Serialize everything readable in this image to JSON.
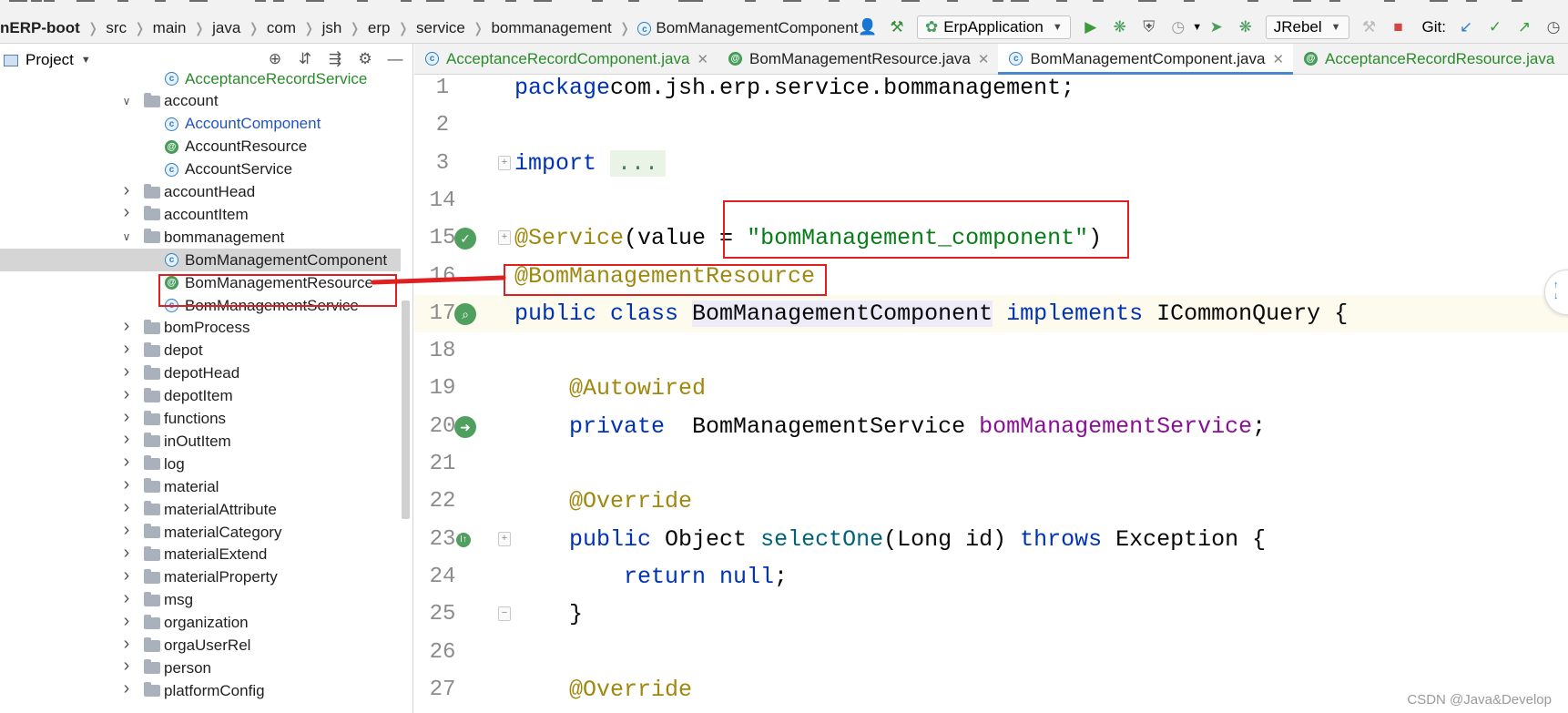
{
  "breadcrumb": {
    "items": [
      "nERP-boot",
      "src",
      "main",
      "java",
      "com",
      "jsh",
      "erp",
      "service",
      "bommanagement"
    ],
    "current": "BomManagementComponent"
  },
  "toolbar": {
    "run_config": "ErpApplication",
    "jrebel": "JRebel",
    "git": "Git:"
  },
  "project_panel": {
    "title": "Project",
    "tree": [
      {
        "label": "AcceptanceRecordService",
        "type": "class",
        "indent": 2,
        "color": "#2b8a2b"
      },
      {
        "label": "account",
        "type": "folder",
        "indent": 1,
        "expanded": true
      },
      {
        "label": "AccountComponent",
        "type": "class",
        "indent": 2,
        "color": "#2455c4"
      },
      {
        "label": "AccountResource",
        "type": "annotation",
        "indent": 2
      },
      {
        "label": "AccountService",
        "type": "class",
        "indent": 2
      },
      {
        "label": "accountHead",
        "type": "folder",
        "indent": 1,
        "expanded": false
      },
      {
        "label": "accountItem",
        "type": "folder",
        "indent": 1,
        "expanded": false
      },
      {
        "label": "bommanagement",
        "type": "folder",
        "indent": 1,
        "expanded": true
      },
      {
        "label": "BomManagementComponent",
        "type": "class",
        "indent": 2,
        "selected": true
      },
      {
        "label": "BomManagementResource",
        "type": "annotation",
        "indent": 2
      },
      {
        "label": "BomManagementService",
        "type": "class",
        "indent": 2
      },
      {
        "label": "bomProcess",
        "type": "folder",
        "indent": 1,
        "expanded": false
      },
      {
        "label": "depot",
        "type": "folder",
        "indent": 1,
        "expanded": false
      },
      {
        "label": "depotHead",
        "type": "folder",
        "indent": 1,
        "expanded": false
      },
      {
        "label": "depotItem",
        "type": "folder",
        "indent": 1,
        "expanded": false
      },
      {
        "label": "functions",
        "type": "folder",
        "indent": 1,
        "expanded": false
      },
      {
        "label": "inOutItem",
        "type": "folder",
        "indent": 1,
        "expanded": false
      },
      {
        "label": "log",
        "type": "folder",
        "indent": 1,
        "expanded": false
      },
      {
        "label": "material",
        "type": "folder",
        "indent": 1,
        "expanded": false
      },
      {
        "label": "materialAttribute",
        "type": "folder",
        "indent": 1,
        "expanded": false
      },
      {
        "label": "materialCategory",
        "type": "folder",
        "indent": 1,
        "expanded": false
      },
      {
        "label": "materialExtend",
        "type": "folder",
        "indent": 1,
        "expanded": false
      },
      {
        "label": "materialProperty",
        "type": "folder",
        "indent": 1,
        "expanded": false
      },
      {
        "label": "msg",
        "type": "folder",
        "indent": 1,
        "expanded": false
      },
      {
        "label": "organization",
        "type": "folder",
        "indent": 1,
        "expanded": false
      },
      {
        "label": "orgaUserRel",
        "type": "folder",
        "indent": 1,
        "expanded": false
      },
      {
        "label": "person",
        "type": "folder",
        "indent": 1,
        "expanded": false
      },
      {
        "label": "platformConfig",
        "type": "folder",
        "indent": 1,
        "expanded": false
      }
    ]
  },
  "tabs": [
    {
      "label": "AcceptanceRecordComponent.java",
      "icon": "class",
      "green": true,
      "active": false
    },
    {
      "label": "BomManagementResource.java",
      "icon": "annotation",
      "green": false,
      "active": false
    },
    {
      "label": "BomManagementComponent.java",
      "icon": "class",
      "green": false,
      "active": true
    },
    {
      "label": "AcceptanceRecordResource.java",
      "icon": "annotation",
      "green": true,
      "active": false
    }
  ],
  "editor": {
    "lines": [
      {
        "num": "1",
        "tokens": [
          [
            "kw",
            "package"
          ],
          [
            "",
            "com.jsh.erp.service.bommanagement;"
          ]
        ]
      },
      {
        "num": "2",
        "tokens": []
      },
      {
        "num": "3",
        "tokens": [
          [
            "kw",
            "import "
          ],
          [
            "foldtext",
            "..."
          ]
        ],
        "fold": true
      },
      {
        "num": "14",
        "tokens": []
      },
      {
        "num": "15",
        "tokens": [
          [
            "an",
            "@Service"
          ],
          [
            "",
            "(value = "
          ],
          [
            "str",
            "\"bomManagement_component\""
          ],
          [
            "",
            ")"
          ]
        ],
        "gutter": "bean",
        "fold": true
      },
      {
        "num": "16",
        "tokens": [
          [
            "an",
            "@BomManagementResource"
          ]
        ]
      },
      {
        "num": "17",
        "tokens": [
          [
            "kw",
            "public class "
          ],
          [
            "hl",
            "BomManagementComponent"
          ],
          [
            "",
            " "
          ],
          [
            "kw",
            "implements "
          ],
          [
            "",
            "ICommonQuery {"
          ]
        ],
        "gutter": "bean-search",
        "current": true
      },
      {
        "num": "18",
        "tokens": []
      },
      {
        "num": "19",
        "tokens": [
          [
            "",
            "    "
          ],
          [
            "an",
            "@Autowired"
          ]
        ]
      },
      {
        "num": "20",
        "tokens": [
          [
            "kw",
            "    private  "
          ],
          [
            "",
            "BomManagementService "
          ],
          [
            "fld",
            "bomManagementService"
          ],
          [
            "",
            ";"
          ]
        ],
        "gutter": "bean-nav"
      },
      {
        "num": "21",
        "tokens": []
      },
      {
        "num": "22",
        "tokens": [
          [
            "",
            "    "
          ],
          [
            "an",
            "@Override"
          ]
        ]
      },
      {
        "num": "23",
        "tokens": [
          [
            "kw",
            "    public "
          ],
          [
            "",
            "Object "
          ],
          [
            "fn",
            "selectOne"
          ],
          [
            "",
            "(Long id) "
          ],
          [
            "kw",
            "throws "
          ],
          [
            "",
            "Exception {"
          ]
        ],
        "gutter": "implements",
        "fold": true
      },
      {
        "num": "24",
        "tokens": [
          [
            "kw",
            "        return null"
          ],
          [
            "",
            ";"
          ]
        ]
      },
      {
        "num": "25",
        "tokens": [
          [
            "",
            "    }"
          ]
        ],
        "fold": true
      },
      {
        "num": "26",
        "tokens": []
      },
      {
        "num": "27",
        "tokens": [
          [
            "",
            "    "
          ],
          [
            "an",
            "@Override"
          ]
        ]
      }
    ]
  },
  "watermark": "CSDN @Java&Develop"
}
